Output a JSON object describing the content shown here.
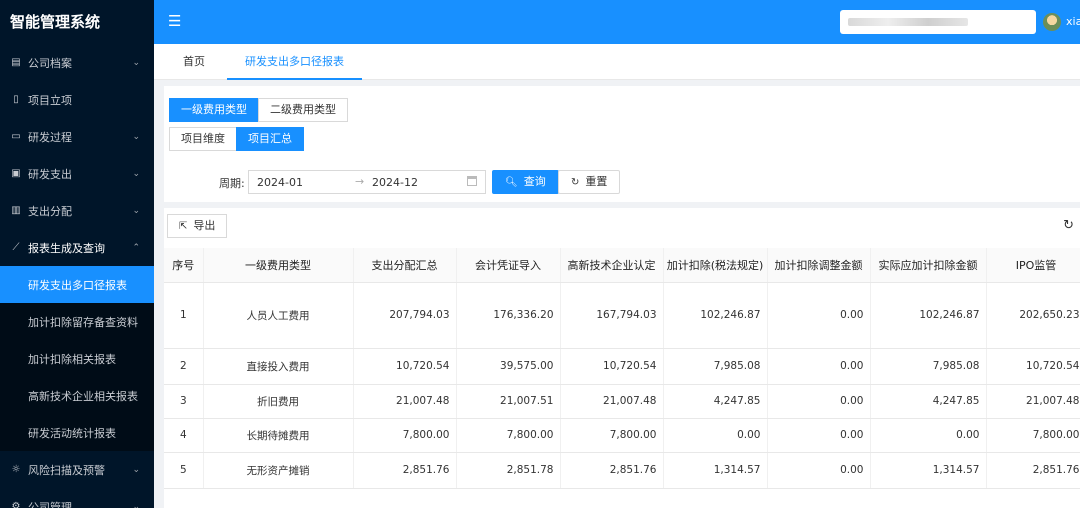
{
  "app": {
    "title": "智能管理系统"
  },
  "sidebar": {
    "items": [
      {
        "label": "公司档案",
        "icon": "archive-icon",
        "has_arrow": true
      },
      {
        "label": "项目立项",
        "icon": "file-icon",
        "has_arrow": false
      },
      {
        "label": "研发过程",
        "icon": "monitor-icon",
        "has_arrow": true
      },
      {
        "label": "研发支出",
        "icon": "expense-icon",
        "has_arrow": true
      },
      {
        "label": "支出分配",
        "icon": "bar-chart-icon",
        "has_arrow": true
      },
      {
        "label": "报表生成及查询",
        "icon": "line-chart-icon",
        "has_arrow": true,
        "open": true
      }
    ],
    "submenu": [
      {
        "label": "研发支出多口径报表",
        "active": true
      },
      {
        "label": "加计扣除留存备查资料"
      },
      {
        "label": "加计扣除相关报表"
      },
      {
        "label": "高新技术企业相关报表"
      },
      {
        "label": "研发活动统计报表"
      }
    ],
    "bottom_items": [
      {
        "label": "风险扫描及预警",
        "icon": "warning-icon",
        "has_arrow": true
      },
      {
        "label": "公司管理",
        "icon": "gear-icon",
        "has_arrow": true
      }
    ]
  },
  "header": {
    "username": "xia"
  },
  "tabs": {
    "home": "首页",
    "active": "研发支出多口径报表"
  },
  "filters": {
    "fee_level_buttons": [
      "一级费用类型",
      "二级费用类型"
    ],
    "dimension_buttons": [
      "项目维度",
      "项目汇总"
    ],
    "period_label": "周期:",
    "period_start": "2024-01",
    "period_end": "2024-12",
    "query_label": "查询",
    "reset_label": "重置"
  },
  "toolbar": {
    "export_label": "导出"
  },
  "table": {
    "columns": [
      "序号",
      "一级费用类型",
      "支出分配汇总",
      "会计凭证导入",
      "高新技术企业认定",
      "加计扣除(税法规定)",
      "加计扣除调整金额",
      "实际应加计扣除金额",
      "IPO监管"
    ],
    "rows": [
      [
        "1",
        "人员人工费用",
        "207,794.03",
        "176,336.20",
        "167,794.03",
        "102,246.87",
        "0.00",
        "102,246.87",
        "202,650.23"
      ],
      [
        "2",
        "直接投入费用",
        "10,720.54",
        "39,575.00",
        "10,720.54",
        "7,985.08",
        "0.00",
        "7,985.08",
        "10,720.54"
      ],
      [
        "3",
        "折旧费用",
        "21,007.48",
        "21,007.51",
        "21,007.48",
        "4,247.85",
        "0.00",
        "4,247.85",
        "21,007.48"
      ],
      [
        "4",
        "长期待摊费用",
        "7,800.00",
        "7,800.00",
        "7,800.00",
        "0.00",
        "0.00",
        "0.00",
        "7,800.00"
      ],
      [
        "5",
        "无形资产摊销",
        "2,851.76",
        "2,851.78",
        "2,851.76",
        "1,314.57",
        "0.00",
        "1,314.57",
        "2,851.76"
      ]
    ]
  },
  "colors": {
    "primary": "#1890ff",
    "sidebar_bg": "#001529",
    "submenu_bg": "#000c17"
  }
}
